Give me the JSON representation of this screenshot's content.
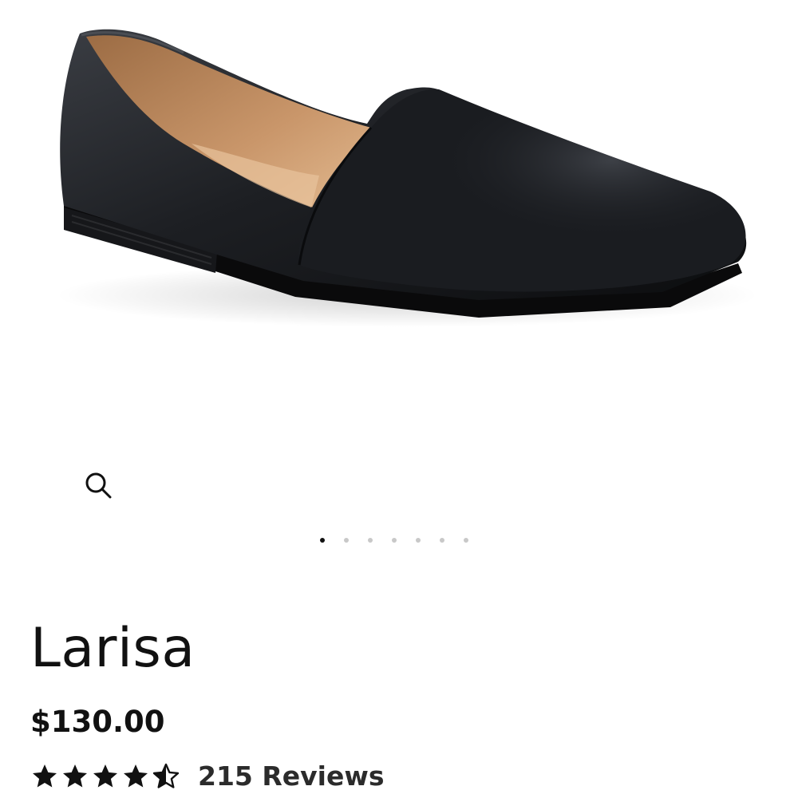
{
  "product": {
    "title": "Larisa",
    "price": "$130.00",
    "rating": 4.5,
    "rating_max": 5,
    "reviews_label": "215 Reviews"
  },
  "gallery": {
    "zoom_icon": "magnifier-icon",
    "slide_count": 7,
    "active_slide": 1,
    "image_description": "black leather slip-on flat shoe"
  },
  "colors": {
    "text": "#111111",
    "dot_inactive": "#c8c8c8",
    "dot_active": "#111111",
    "background": "#ffffff"
  }
}
